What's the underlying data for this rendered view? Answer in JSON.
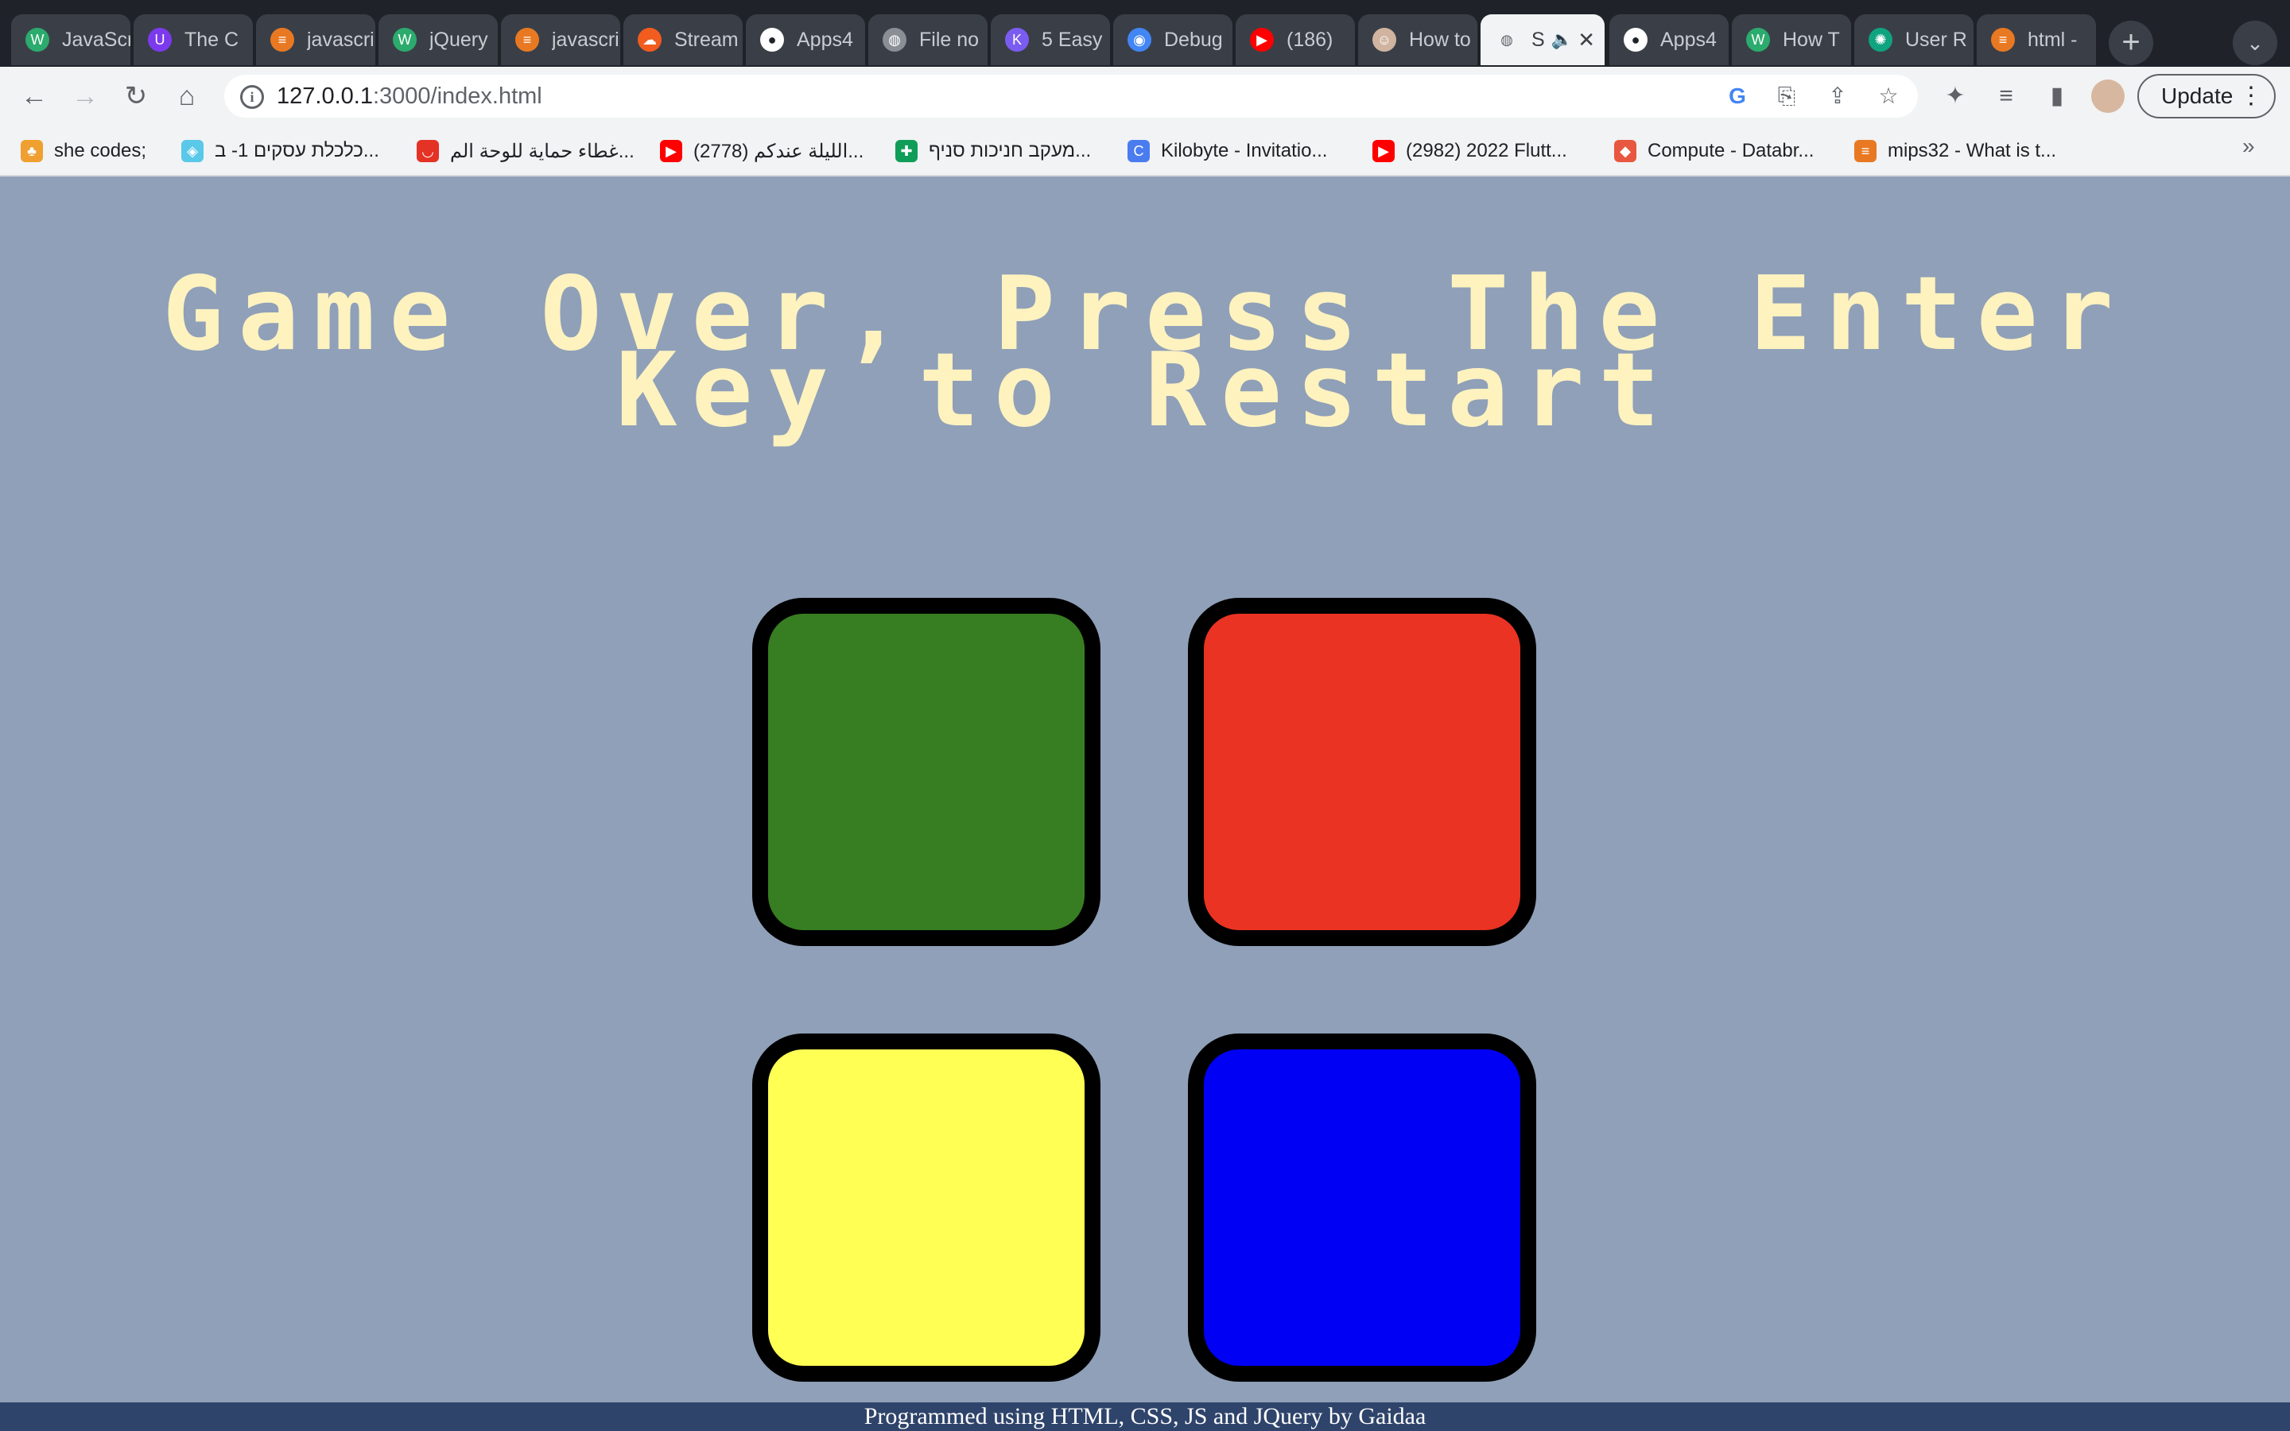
{
  "browser": {
    "tabs": [
      {
        "title": "JavaScript",
        "favicon": "w-icon",
        "color": "#2bab6d",
        "active": false
      },
      {
        "title": "The C",
        "favicon": "u-icon",
        "color": "#7c3aed",
        "active": false
      },
      {
        "title": "javascript",
        "favicon": "stack-icon",
        "color": "#e87922",
        "active": false
      },
      {
        "title": "jQuery",
        "favicon": "w-icon",
        "color": "#2bab6d",
        "active": false
      },
      {
        "title": "javascript",
        "favicon": "stack-icon",
        "color": "#e87922",
        "active": false
      },
      {
        "title": "Stream",
        "favicon": "soundcloud-icon",
        "color": "#f25c1f",
        "active": false
      },
      {
        "title": "Apps4",
        "favicon": "github-icon",
        "color": "#ffffff",
        "active": false
      },
      {
        "title": "File no",
        "favicon": "globe-icon",
        "color": "#8a8f96",
        "active": false
      },
      {
        "title": "5 Easy",
        "favicon": "k-icon",
        "color": "#7b5cf0",
        "active": false
      },
      {
        "title": "Debug",
        "favicon": "chrome-icon",
        "color": "#4285f4",
        "active": false
      },
      {
        "title": "(186)",
        "favicon": "youtube-icon",
        "color": "#ff0000",
        "active": false
      },
      {
        "title": "How to",
        "favicon": "avatar-icon",
        "color": "#d0b4a0",
        "active": false
      },
      {
        "title": "S",
        "favicon": "globe-icon",
        "color": "#5f6368",
        "active": true
      },
      {
        "title": "Apps4",
        "favicon": "github-icon",
        "color": "#ffffff",
        "active": false
      },
      {
        "title": "How T",
        "favicon": "w-icon",
        "color": "#2bab6d",
        "active": false
      },
      {
        "title": "User R",
        "favicon": "openai-icon",
        "color": "#10a37f",
        "active": false
      },
      {
        "title": "html -",
        "favicon": "stack-icon",
        "color": "#e87922",
        "active": false
      }
    ],
    "url_host": "127.0.0.1",
    "url_rest": ":3000/index.html",
    "update_label": "Update",
    "bookmarks": [
      {
        "label": "she codes;",
        "icon": "she-codes-icon",
        "color": "#f0a030"
      },
      {
        "label": "כלכלת עסקים 1- ב...",
        "icon": "book-icon",
        "color": "#5ac8e8"
      },
      {
        "label": "غطاء حماية للوحة الم...",
        "icon": "aliexpress-icon",
        "color": "#e43225"
      },
      {
        "label": "(2778) الليلة عندكم...",
        "icon": "youtube-icon",
        "color": "#ff0000"
      },
      {
        "label": "מעקב חניכות סניף...",
        "icon": "sheets-icon",
        "color": "#0f9d58"
      },
      {
        "label": "Kilobyte - Invitatio...",
        "icon": "c-icon",
        "color": "#4a7cf0"
      },
      {
        "label": "(2982) 2022 Flutt...",
        "icon": "youtube-icon",
        "color": "#ff0000"
      },
      {
        "label": "Compute - Databr...",
        "icon": "databricks-icon",
        "color": "#e8573f"
      },
      {
        "label": "mips32 - What is t...",
        "icon": "stack-icon",
        "color": "#e87922"
      }
    ]
  },
  "game": {
    "title": "Game Over, Press The Enter Key to Restart",
    "title_color": "#fef2bf",
    "background": "#8fa0b8",
    "pads": [
      {
        "id": "green",
        "color": "#377e22"
      },
      {
        "id": "red",
        "color": "#ea3323"
      },
      {
        "id": "yellow",
        "color": "#ffff54"
      },
      {
        "id": "blue",
        "color": "#0000f5"
      }
    ]
  },
  "footer": {
    "text": "Programmed using HTML, CSS, JS and JQuery by Gaidaa",
    "background": "#2f446b"
  }
}
